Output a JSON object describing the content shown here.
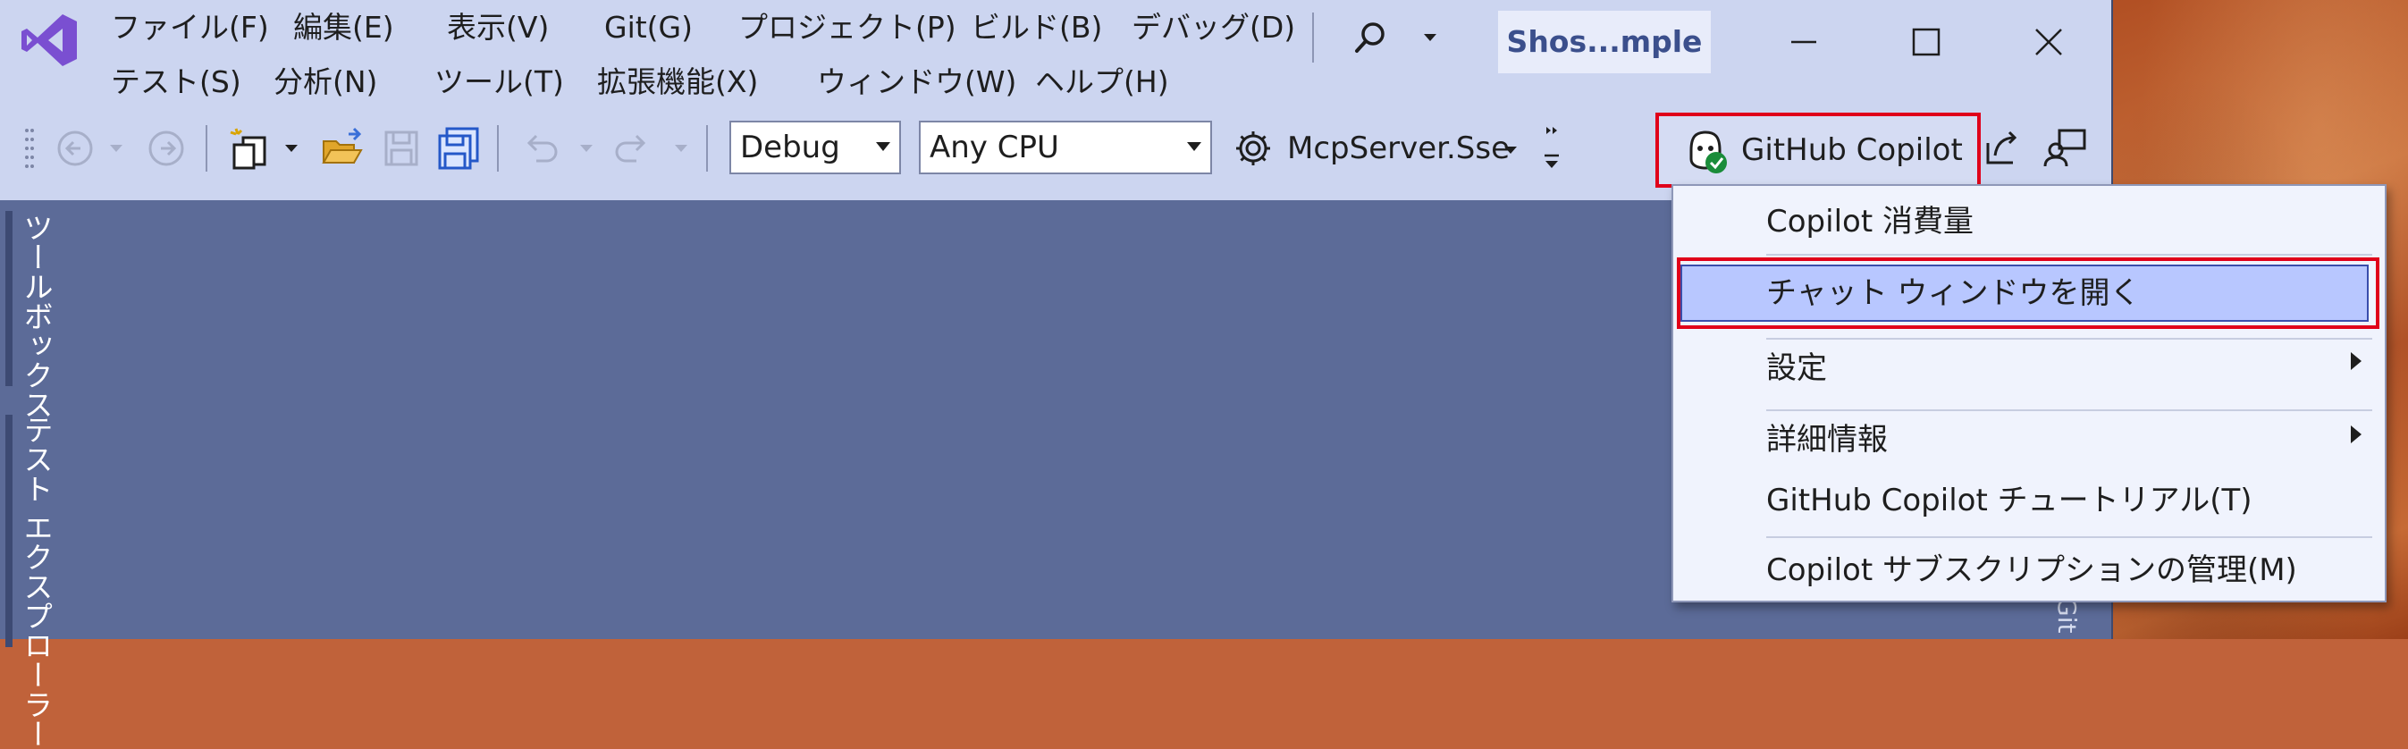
{
  "menu": {
    "row1": [
      "ファイル(F)",
      "編集(E)",
      "表示(V)",
      "Git(G)",
      "プロジェクト(P)",
      "ビルド(B)",
      "デバッグ(D)"
    ],
    "row2": [
      "テスト(S)",
      "分析(N)",
      "ツール(T)",
      "拡張機能(X)",
      "ウィンドウ(W)",
      "ヘルプ(H)"
    ]
  },
  "window": {
    "title": "Shos...mple"
  },
  "toolbar": {
    "configuration": "Debug",
    "platform": "Any CPU",
    "startup_project": "McpServer.Sse",
    "copilot_label": "GitHub Copilot"
  },
  "side_tabs": [
    "ツールボックス",
    "テスト エクスプローラー"
  ],
  "right_hint": "Git",
  "copilot_menu": {
    "items": [
      {
        "label": "Copilot 消費量",
        "submenu": false
      },
      {
        "label": "チャット ウィンドウを開く",
        "submenu": false,
        "highlighted": true
      },
      {
        "label": "設定",
        "submenu": true
      },
      {
        "label": "詳細情報",
        "submenu": true
      },
      {
        "label": "GitHub Copilot チュートリアル(T)",
        "submenu": false
      },
      {
        "label": "Copilot サブスクリプションの管理(M)",
        "submenu": false
      }
    ]
  },
  "colors": {
    "accent_red": "#e0001a",
    "topbar": "#ccd5f0",
    "workspace": "#5c6b98",
    "menu_highlight": "#b8c7ff"
  }
}
